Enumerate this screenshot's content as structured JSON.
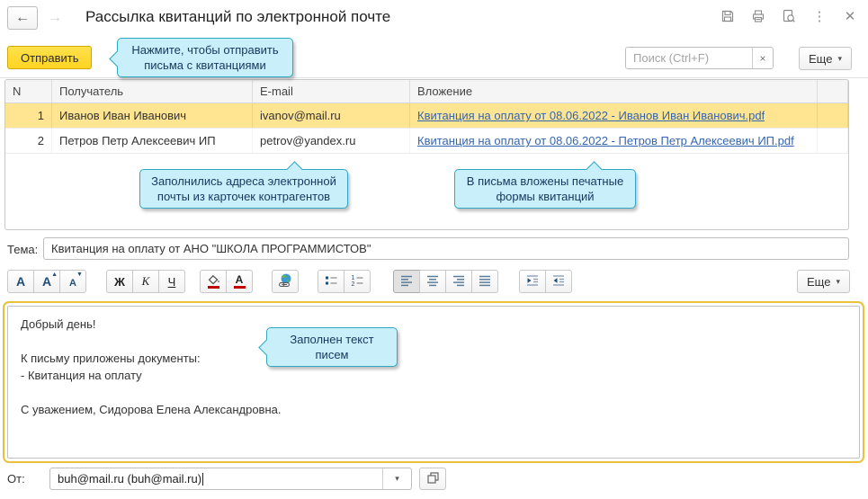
{
  "header": {
    "title": "Рассылка квитанций по электронной почте"
  },
  "ui": {
    "back_arrow": "←",
    "forward_arrow": "→",
    "kebab": "⋮",
    "close": "✕",
    "dropdown_arrow": "▾",
    "clear_x": "×"
  },
  "actions": {
    "send_label": "Отправить",
    "more_label": "Еще",
    "search_placeholder": "Поиск (Ctrl+F)"
  },
  "callouts": {
    "send": "Нажмите, чтобы отправить письма с квитанциями",
    "emails": "Заполнились адреса электронной почты из карточек контрагентов",
    "attachments": "В письма вложены печатные формы квитанций",
    "body": "Заполнен текст писем"
  },
  "table": {
    "columns": [
      "N",
      "Получатель",
      "E-mail",
      "Вложение"
    ],
    "rows": [
      {
        "n": "1",
        "recipient": "Иванов Иван Иванович",
        "email": "ivanov@mail.ru",
        "attachment": "Квитанция на оплату от 08.06.2022 - Иванов Иван Иванович.pdf"
      },
      {
        "n": "2",
        "recipient": "Петров Петр Алексеевич ИП",
        "email": "petrov@yandex.ru",
        "attachment": "Квитанция на оплату от 08.06.2022 - Петров Петр Алексеевич ИП.pdf"
      }
    ]
  },
  "subject": {
    "label": "Тема:",
    "value": "Квитанция на оплату от АНО \"ШКОЛА ПРОГРАММИСТОВ\""
  },
  "editor": {
    "more_label": "Еще",
    "font_letter": "А",
    "bold_letter": "Ж",
    "italic_letter": "К",
    "underline_letter": "Ч",
    "fontcolor_letter": "А",
    "grow_arrow": "▲",
    "shrink_arrow": "▼"
  },
  "body": {
    "lines": [
      "Добрый день!",
      "",
      "К письму приложены документы:",
      "- Квитанция на оплату",
      "",
      "С уважением, Сидорова Елена Александровна."
    ]
  },
  "from": {
    "label": "От:",
    "value": "buh@mail.ru (buh@mail.ru)"
  },
  "colors": {
    "accent_yellow": "#ffd424",
    "selected_row": "#ffe592",
    "callout_bg": "#c9f0fa",
    "callout_border": "#2fa8c8",
    "link": "#3565af"
  }
}
